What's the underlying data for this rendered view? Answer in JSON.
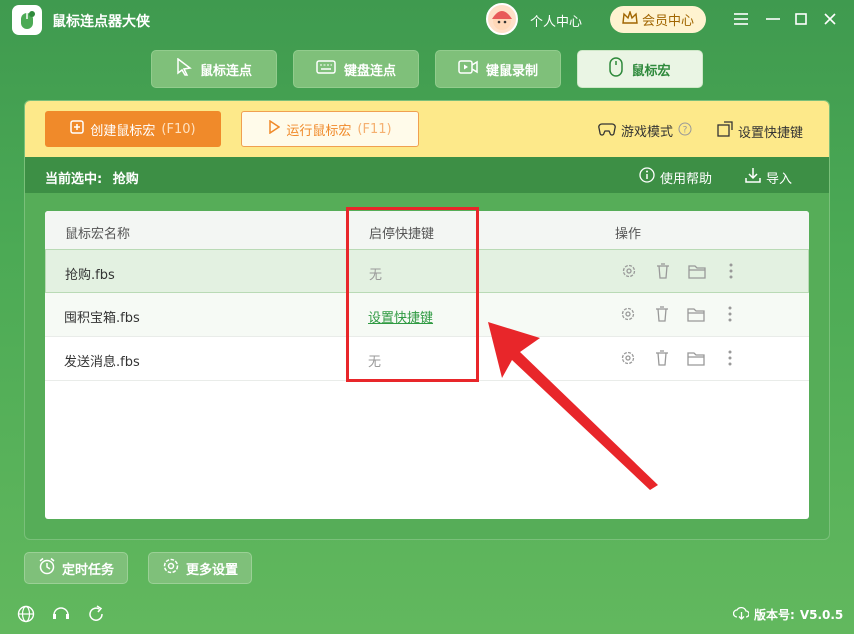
{
  "app": {
    "title": "鼠标连点器大侠"
  },
  "header": {
    "user_center": "个人中心",
    "vip": "会员中心"
  },
  "tabs": [
    {
      "label": "鼠标连点",
      "icon": "cursor-icon"
    },
    {
      "label": "键盘连点",
      "icon": "keyboard-icon"
    },
    {
      "label": "键鼠录制",
      "icon": "video-icon"
    },
    {
      "label": "鼠标宏",
      "icon": "mouse-icon",
      "active": true
    }
  ],
  "toolbar": {
    "create_label": "创建鼠标宏",
    "create_key": "(F10)",
    "run_label": "运行鼠标宏",
    "run_key": "(F11)",
    "game_mode": "游戏模式",
    "set_hotkey": "设置快捷键"
  },
  "status": {
    "current_label": "当前选中:",
    "current_value": "抢购",
    "help": "使用帮助",
    "import": "导入"
  },
  "table": {
    "headers": {
      "name": "鼠标宏名称",
      "hotkey": "启停快捷键",
      "ops": "操作"
    },
    "rows": [
      {
        "name": "抢购.fbs",
        "hotkey": "无"
      },
      {
        "name": "囤积宝箱.fbs",
        "hotkey": "设置快捷键"
      },
      {
        "name": "发送消息.fbs",
        "hotkey": "无"
      }
    ]
  },
  "bottom": {
    "timer": "定时任务",
    "more": "更多设置"
  },
  "footer": {
    "version_label": "版本号:",
    "version_value": "V5.0.5"
  },
  "colors": {
    "accent": "#f08a2a",
    "brand": "#4caa55",
    "highlight": "#e8262a"
  }
}
